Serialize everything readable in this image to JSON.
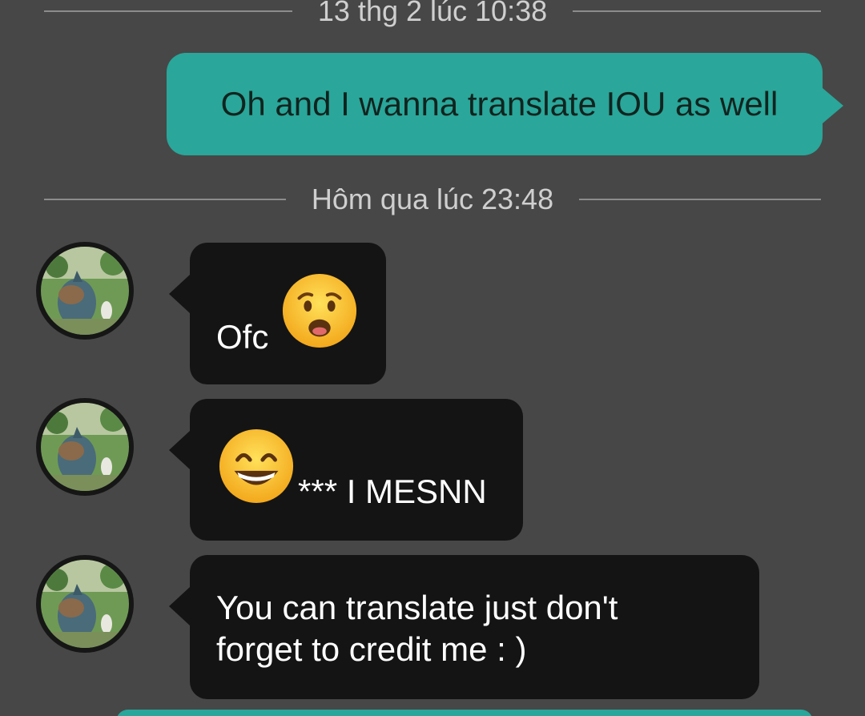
{
  "dividers": [
    {
      "label": "13 thg 2 lúc 10:38"
    },
    {
      "label": "Hôm qua lúc 23:48"
    }
  ],
  "messages": {
    "outgoing": [
      {
        "text": "Oh and I wanna translate IOU as well"
      }
    ],
    "incoming": [
      {
        "text": "Ofc",
        "emoji": "anguished-face-emoji"
      },
      {
        "text": "*** I MESNN",
        "emoji": "grinning-face-emoji"
      },
      {
        "line1": "You can translate just don't",
        "line2": "forget to credit me : )"
      }
    ]
  },
  "colors": {
    "background": "#474747",
    "outgoing_bubble": "#2aa69a",
    "incoming_bubble": "#141414",
    "divider_text": "#cfcfcf"
  }
}
